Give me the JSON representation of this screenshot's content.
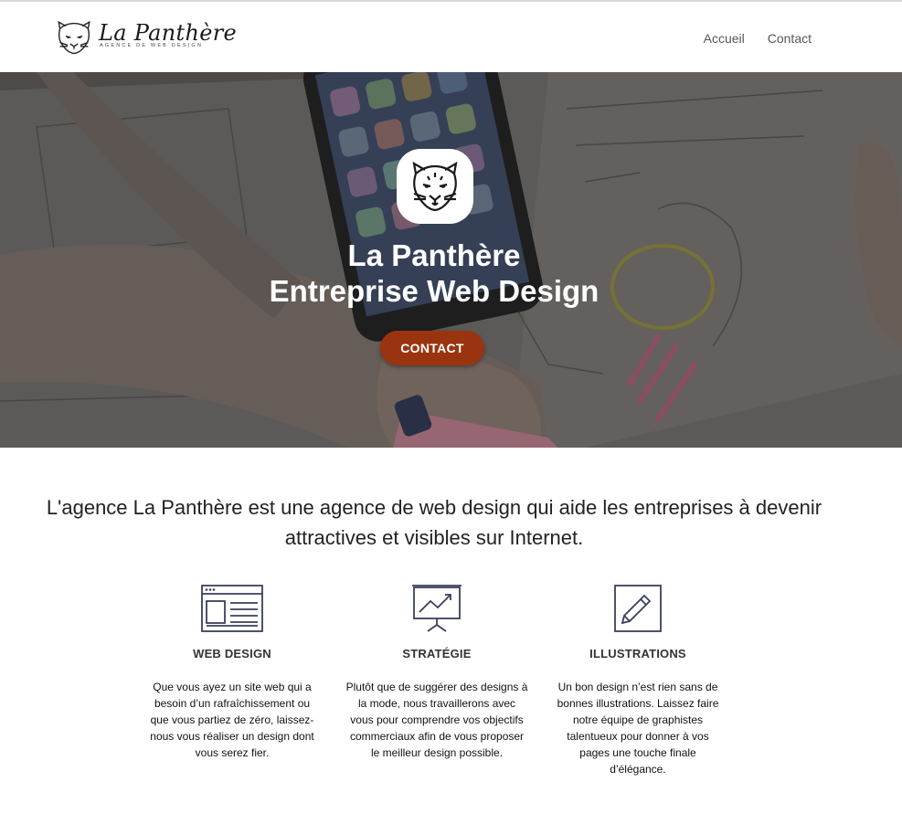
{
  "header": {
    "logo_name": "La Panthère",
    "logo_tagline": "AGENCE DE WEB DESIGN",
    "nav": [
      {
        "label": "Accueil"
      },
      {
        "label": "Contact"
      }
    ]
  },
  "hero": {
    "title_line1": "La Panthère",
    "title_line2": "Entreprise Web Design",
    "cta_label": "CONTACT",
    "badge_icon": "panther-head-icon"
  },
  "intro": {
    "text": "L'agence La Panthère est une agence de web design qui aide les entreprises à devenir attractives et visibles sur Internet."
  },
  "features": [
    {
      "icon": "browser-window-icon",
      "title": "WEB DESIGN",
      "text": "Que vous ayez un site web qui a besoin d’un rafraîchissement ou que vous partiez de zéro, laissez-nous vous réaliser un design dont vous serez fier."
    },
    {
      "icon": "presentation-chart-icon",
      "title": "STRATÉGIE",
      "text": "Plutôt que de suggérer des designs à la mode, nous travaillerons avec vous pour comprendre vos objectifs commerciaux afin de vous proposer le meilleur design possible."
    },
    {
      "icon": "pencil-square-icon",
      "title": "ILLUSTRATIONS",
      "text": "Un bon design n’est rien sans de bonnes illustrations. Laissez faire notre équipe de graphistes talentueux pour donner à vos pages une touche finale d’élégance."
    }
  ],
  "colors": {
    "accent_button": "#9a3410",
    "icon_stroke": "#3a3f5c",
    "text": "#222222"
  }
}
